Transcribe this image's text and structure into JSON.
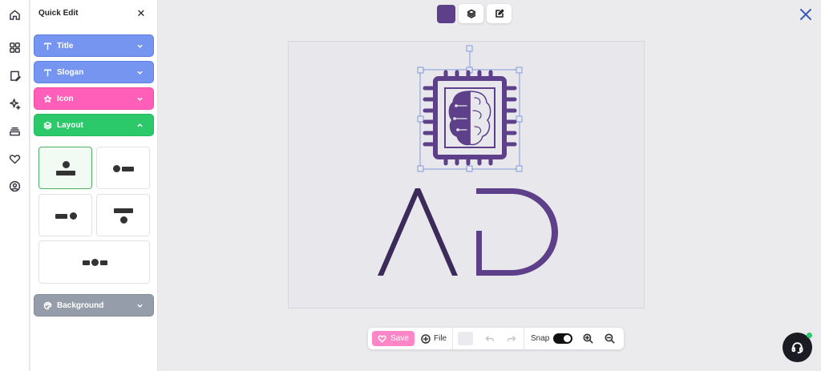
{
  "colors": {
    "brand_purple": "#5d3f8a",
    "title_blue": "#6b8ff0",
    "icon_pink": "#ff5fb8",
    "layout_green": "#2cc96a",
    "background_gray": "#8f97a6",
    "save_pink": "#ff86c6",
    "online_green": "#2ec76b"
  },
  "rail": {
    "icons": [
      "home-icon",
      "grid-icon",
      "edit-page-icon",
      "magic-icon",
      "layers-icon",
      "heart-icon",
      "user-circle-icon"
    ]
  },
  "quick_edit": {
    "title": "Quick Edit",
    "close_symbol": "✕",
    "sections": {
      "title": "Title",
      "slogan": "Slogan",
      "icon": "Icon",
      "layout": "Layout",
      "background": "Background"
    },
    "layout_options": [
      "icon-top",
      "icon-left",
      "icon-right",
      "icon-bottom",
      "icon-center"
    ],
    "selected_layout": "icon-top"
  },
  "top_toolbar": {
    "icons": [
      "color-swatch",
      "layers-icon",
      "edit-icon"
    ]
  },
  "logo": {
    "text": "AD"
  },
  "bottom_toolbar": {
    "save_label": "Save",
    "file_label": "File",
    "snap_label": "Snap",
    "snap_on": true
  }
}
